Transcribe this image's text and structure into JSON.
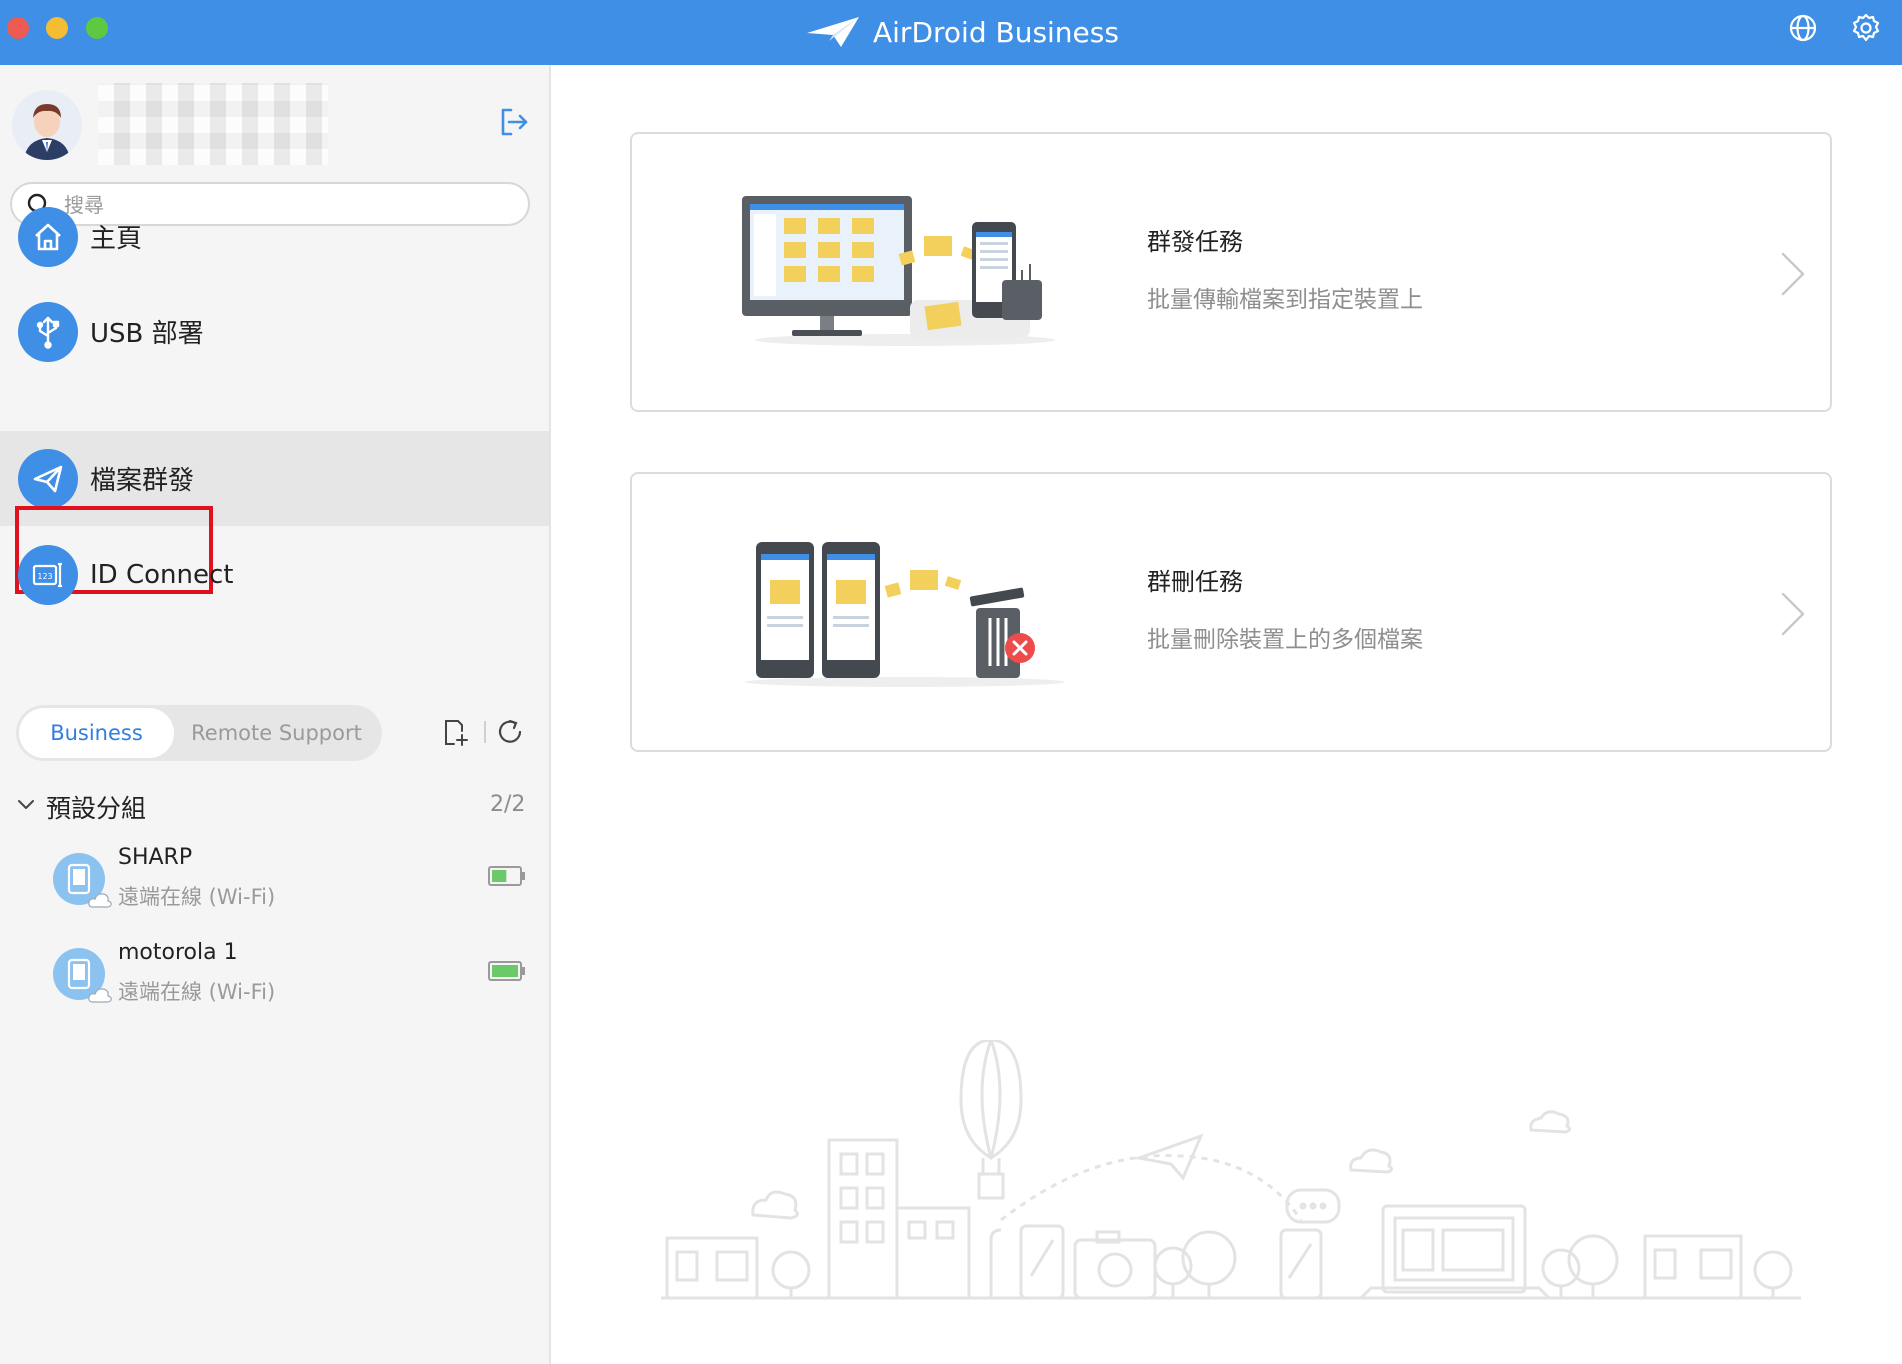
{
  "window": {
    "app_title": "AirDroid Business"
  },
  "sidebar": {
    "search": {
      "placeholder": "搜尋"
    },
    "nav": [
      {
        "label": "主頁",
        "icon": "home-icon"
      },
      {
        "label": "USB 部署",
        "icon": "usb-icon"
      },
      {
        "label": "檔案群發",
        "icon": "send-icon",
        "active": true
      },
      {
        "label": "ID Connect",
        "icon": "id-connect-icon"
      }
    ],
    "segments": {
      "business": "Business",
      "remote_support": "Remote Support",
      "selected": "Business"
    },
    "group": {
      "name": "預設分組",
      "count": "2/2"
    },
    "devices": [
      {
        "name": "SHARP",
        "status": "遠端在線 (Wi-Fi)",
        "battery_level": 0.55
      },
      {
        "name": "motorola 1",
        "status": "遠端在線 (Wi-Fi)",
        "battery_level": 1.0
      }
    ]
  },
  "main": {
    "cards": [
      {
        "title": "群發任務",
        "description": "批量傳輸檔案到指定裝置上"
      },
      {
        "title": "群刪任務",
        "description": "批量刪除裝置上的多個檔案"
      }
    ]
  },
  "colors": {
    "accent": "#3f8fe6",
    "highlight_border": "#e0101c",
    "battery_green": "#6cc96a"
  }
}
